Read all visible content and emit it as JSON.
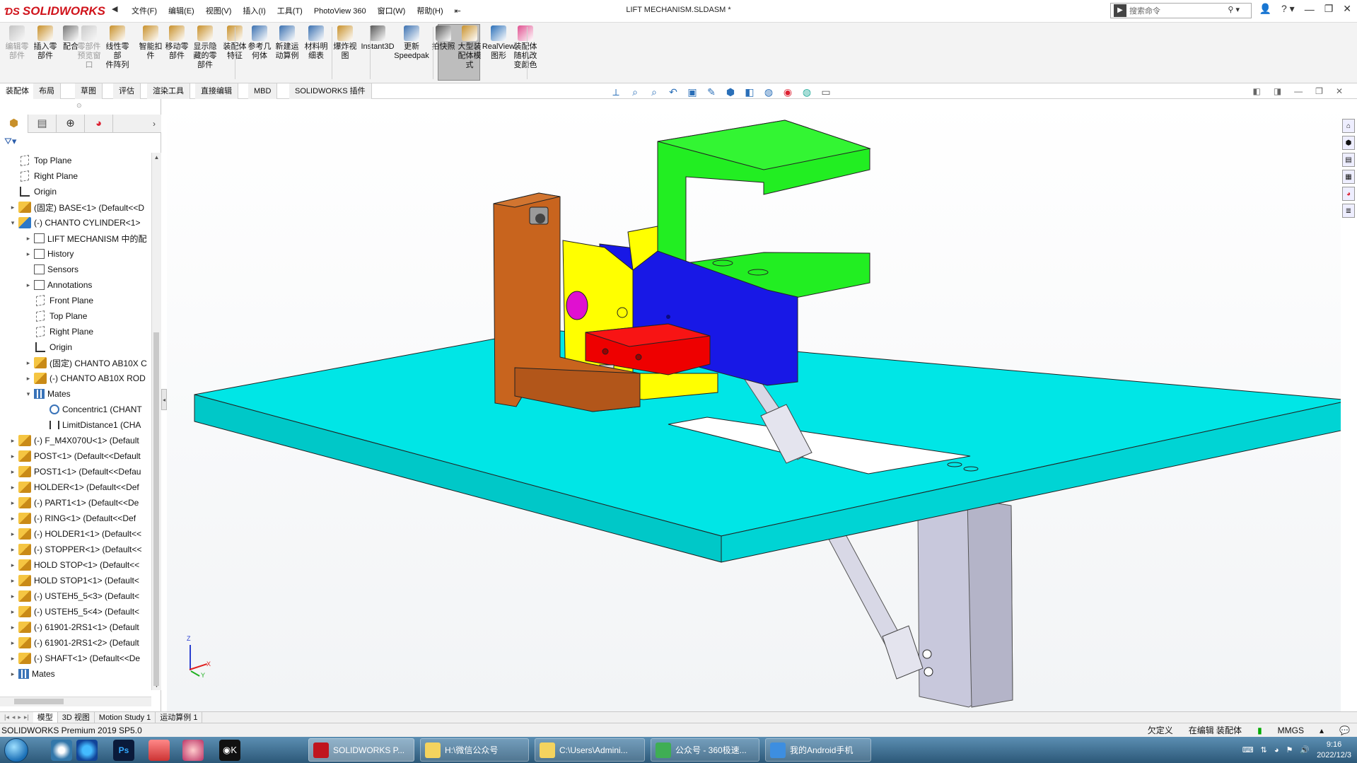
{
  "app": {
    "brand": "SOLIDWORKS",
    "doc_title": "LIFT MECHANISM.SLDASM *",
    "search_placeholder": "搜索命令"
  },
  "menu": [
    "文件(F)",
    "编辑(E)",
    "视图(V)",
    "插入(I)",
    "工具(T)",
    "PhotoView 360",
    "窗口(W)",
    "帮助(H)"
  ],
  "toolbar": {
    "tools": [
      {
        "label": "编辑零\n部件",
        "icon": "edit-component-icon",
        "disabled": true
      },
      {
        "label": "插入零\n部件",
        "icon": "insert-component-icon",
        "disabled": false
      },
      {
        "label": "配合",
        "icon": "mate-icon",
        "disabled": false
      },
      {
        "label": "零部件\n预览窗\n口",
        "icon": "component-preview-icon",
        "disabled": true
      },
      {
        "label": "线性零部\n件阵列",
        "icon": "linear-pattern-icon",
        "disabled": false
      },
      {
        "label": "智能扣\n件",
        "icon": "smart-fasteners-icon",
        "disabled": false
      },
      {
        "label": "移动零\n部件",
        "icon": "move-component-icon",
        "disabled": false
      },
      {
        "label": "显示隐\n藏的零\n部件",
        "icon": "show-hidden-icon",
        "disabled": false
      },
      {
        "label": "装配体\n特征",
        "icon": "assembly-features-icon",
        "disabled": false
      },
      {
        "label": "参考几\n何体",
        "icon": "reference-geometry-icon",
        "disabled": false
      },
      {
        "label": "新建运\n动算例",
        "icon": "new-motion-study-icon",
        "disabled": false
      },
      {
        "label": "材料明\n细表",
        "icon": "bom-icon",
        "disabled": false
      },
      {
        "label": "爆炸视\n图",
        "icon": "exploded-view-icon",
        "disabled": false
      },
      {
        "label": "Instant3D",
        "icon": "instant3d-icon",
        "disabled": false
      },
      {
        "label": "更新\nSpeedpak",
        "icon": "speedpak-icon",
        "disabled": false
      },
      {
        "label": "拍快照",
        "icon": "snapshot-icon",
        "disabled": false
      },
      {
        "label": "大型装\n配体模\n式",
        "icon": "large-assembly-icon",
        "disabled": false
      },
      {
        "label": "RealView\n图形",
        "icon": "realview-icon",
        "disabled": false
      },
      {
        "label": "装配体\n随机改\n变颜色",
        "icon": "random-color-icon",
        "disabled": false
      }
    ]
  },
  "tabs": [
    "装配体",
    "布局",
    "草图",
    "评估",
    "渲染工具",
    "直接编辑",
    "MBD",
    "SOLIDWORKS 插件"
  ],
  "tree": [
    {
      "label": "Top Plane",
      "icon": "plane",
      "level": 0,
      "expander": ""
    },
    {
      "label": "Right Plane",
      "icon": "plane",
      "level": 0,
      "expander": ""
    },
    {
      "label": "Origin",
      "icon": "origin",
      "level": 0,
      "expander": ""
    },
    {
      "label": "(固定) BASE<1> (Default<<D",
      "icon": "part",
      "level": 0,
      "expander": "▸"
    },
    {
      "label": "(-) CHANTO CYLINDER<1>",
      "icon": "asm",
      "level": 0,
      "expander": "▾"
    },
    {
      "label": "LIFT MECHANISM 中的配",
      "icon": "folder",
      "level": 1,
      "expander": "▸"
    },
    {
      "label": "History",
      "icon": "folder",
      "level": 1,
      "expander": "▸"
    },
    {
      "label": "Sensors",
      "icon": "folder",
      "level": 1,
      "expander": ""
    },
    {
      "label": "Annotations",
      "icon": "folder",
      "level": 1,
      "expander": "▸"
    },
    {
      "label": "Front Plane",
      "icon": "plane",
      "level": 1,
      "expander": ""
    },
    {
      "label": "Top Plane",
      "icon": "plane",
      "level": 1,
      "expander": ""
    },
    {
      "label": "Right Plane",
      "icon": "plane",
      "level": 1,
      "expander": ""
    },
    {
      "label": "Origin",
      "icon": "origin",
      "level": 1,
      "expander": ""
    },
    {
      "label": "(固定) CHANTO AB10X C",
      "icon": "part",
      "level": 1,
      "expander": "▸"
    },
    {
      "label": "(-) CHANTO AB10X ROD",
      "icon": "part",
      "level": 1,
      "expander": "▸"
    },
    {
      "label": "Mates",
      "icon": "mates",
      "level": 1,
      "expander": "▾"
    },
    {
      "label": "Concentric1 (CHANT",
      "icon": "mate1",
      "level": 2,
      "expander": ""
    },
    {
      "label": "LimitDistance1 (CHA",
      "icon": "mate2",
      "level": 2,
      "expander": ""
    },
    {
      "label": "(-) F_M4X070U<1> (Default",
      "icon": "part",
      "level": 0,
      "expander": "▸"
    },
    {
      "label": "POST<1> (Default<<Default",
      "icon": "part",
      "level": 0,
      "expander": "▸"
    },
    {
      "label": "POST1<1> (Default<<Defau",
      "icon": "part",
      "level": 0,
      "expander": "▸"
    },
    {
      "label": "HOLDER<1> (Default<<Def",
      "icon": "part",
      "level": 0,
      "expander": "▸"
    },
    {
      "label": "(-) PART1<1> (Default<<De",
      "icon": "part",
      "level": 0,
      "expander": "▸"
    },
    {
      "label": "(-) RING<1> (Default<<Def",
      "icon": "part",
      "level": 0,
      "expander": "▸"
    },
    {
      "label": "(-) HOLDER1<1> (Default<<",
      "icon": "part",
      "level": 0,
      "expander": "▸"
    },
    {
      "label": "(-) STOPPER<1> (Default<<",
      "icon": "part",
      "level": 0,
      "expander": "▸"
    },
    {
      "label": "HOLD STOP<1> (Default<<",
      "icon": "part",
      "level": 0,
      "expander": "▸"
    },
    {
      "label": "HOLD STOP1<1> (Default<",
      "icon": "part",
      "level": 0,
      "expander": "▸"
    },
    {
      "label": "(-) USTEH5_5<3> (Default<",
      "icon": "part",
      "level": 0,
      "expander": "▸"
    },
    {
      "label": "(-) USTEH5_5<4> (Default<",
      "icon": "part",
      "level": 0,
      "expander": "▸"
    },
    {
      "label": "(-) 61901-2RS1<1> (Default",
      "icon": "part",
      "level": 0,
      "expander": "▸"
    },
    {
      "label": "(-) 61901-2RS1<2> (Default",
      "icon": "part",
      "level": 0,
      "expander": "▸"
    },
    {
      "label": "(-) SHAFT<1> (Default<<De",
      "icon": "part",
      "level": 0,
      "expander": "▸"
    },
    {
      "label": "Mates",
      "icon": "mates",
      "level": 0,
      "expander": "▸"
    }
  ],
  "bottom_tabs": [
    "模型",
    "3D 视图",
    "Motion Study 1",
    "运动算例 1"
  ],
  "status": {
    "left": "SOLIDWORKS Premium 2019 SP5.0",
    "right": [
      "欠定义",
      "在编辑 装配体",
      "MMGS"
    ]
  },
  "taskbar": {
    "buttons": [
      {
        "label": "SOLIDWORKS P...",
        "icon": "solidworks-icon",
        "active": true
      },
      {
        "label": "H:\\微信公众号",
        "icon": "folder-icon",
        "active": false
      },
      {
        "label": "C:\\Users\\Admini...",
        "icon": "folder-icon",
        "active": false
      },
      {
        "label": "公众号 - 360极速...",
        "icon": "browser-icon",
        "active": false
      },
      {
        "label": "我的Android手机",
        "icon": "phone-icon",
        "active": false
      }
    ],
    "time": "9:16",
    "date": "2022/12/3"
  },
  "colors": {
    "base_plate": "#00e0e0",
    "green_bracket": "#22ee22",
    "blue_block": "#1515e6",
    "yellow_block": "#ffff00",
    "red_block": "#ee0000",
    "brown_bracket": "#c8641e",
    "magenta_circle": "#e010d0",
    "gray_post": "#c9c9dc"
  }
}
